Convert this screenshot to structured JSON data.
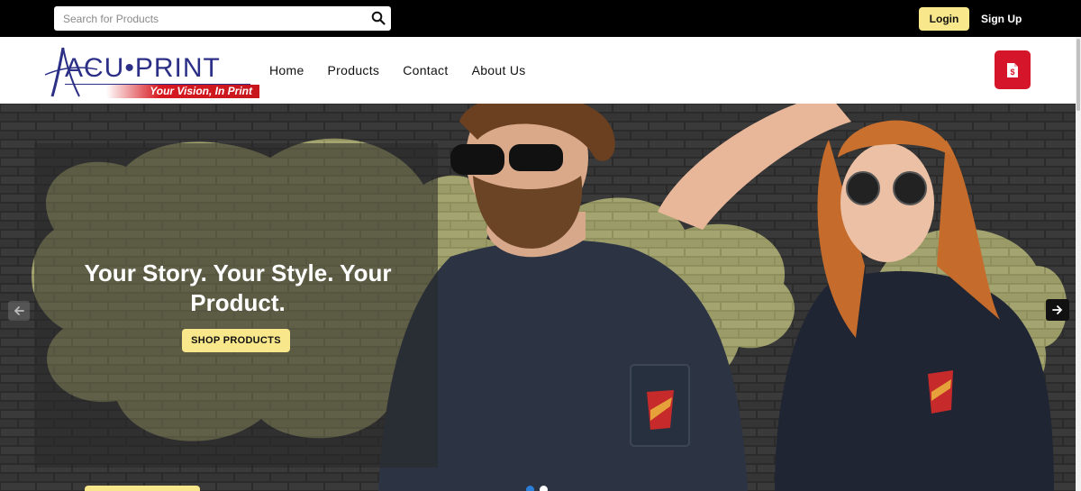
{
  "topbar": {
    "search": {
      "placeholder": "Search for Products",
      "value": ""
    },
    "login_label": "Login",
    "signup_label": "Sign Up"
  },
  "header": {
    "logo": {
      "text": "ACU•PRINT",
      "tagline": "Your Vision, In Print"
    },
    "nav": [
      {
        "label": "Home"
      },
      {
        "label": "Products"
      },
      {
        "label": "Contact"
      },
      {
        "label": "About Us"
      }
    ],
    "quote_icon": "dollar-document-icon"
  },
  "hero": {
    "title": "Your Story. Your Style. Your Product.",
    "cta_label": "SHOP PRODUCTS",
    "slides": 2,
    "active_slide": 2
  },
  "colors": {
    "accent_yellow": "#f9e88b",
    "brand_red": "#d5162a",
    "brand_blue": "#2b2f86",
    "topbar": "#000000"
  }
}
